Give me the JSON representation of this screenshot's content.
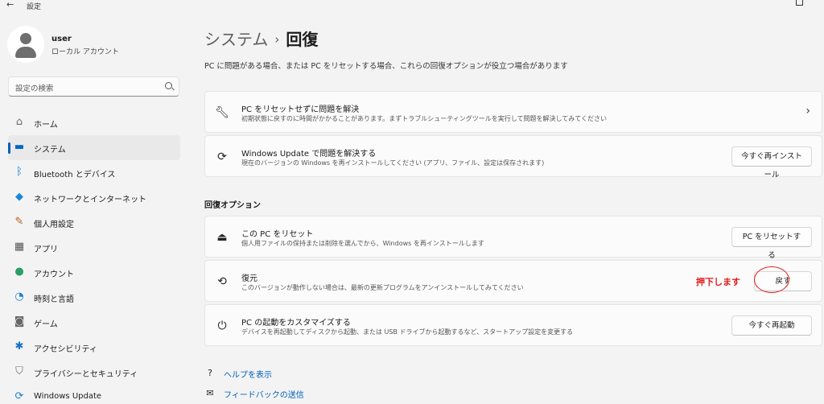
{
  "window": {
    "back_glyph": "←",
    "title": "設定"
  },
  "profile": {
    "name": "user",
    "account_type": "ローカル アカウント"
  },
  "search": {
    "placeholder": "設定の検索"
  },
  "nav": {
    "items": [
      {
        "label": "ホーム",
        "icon": "home-icon",
        "glyph": "⌂",
        "color": "#6b6b6b"
      },
      {
        "label": "システム",
        "icon": "monitor-icon",
        "glyph": "▬",
        "color": "#0067c0"
      },
      {
        "label": "Bluetooth とデバイス",
        "icon": "bluetooth-icon",
        "glyph": "ᛒ",
        "color": "#0a78d4"
      },
      {
        "label": "ネットワークとインターネット",
        "icon": "wifi-icon",
        "glyph": "◆",
        "color": "#1a86d8"
      },
      {
        "label": "個人用設定",
        "icon": "paintbrush-icon",
        "glyph": "✎",
        "color": "#b25c1c"
      },
      {
        "label": "アプリ",
        "icon": "apps-icon",
        "glyph": "▦",
        "color": "#555555"
      },
      {
        "label": "アカウント",
        "icon": "person-icon",
        "glyph": "●",
        "color": "#2a9d6a"
      },
      {
        "label": "時刻と言語",
        "icon": "globe-clock-icon",
        "glyph": "◔",
        "color": "#1a7fd0"
      },
      {
        "label": "ゲーム",
        "icon": "gamepad-icon",
        "glyph": "◙",
        "color": "#666666"
      },
      {
        "label": "アクセシビリティ",
        "icon": "accessibility-icon",
        "glyph": "✱",
        "color": "#1470c8"
      },
      {
        "label": "プライバシーとセキュリティ",
        "icon": "shield-icon",
        "glyph": "⛉",
        "color": "#6b6b6b"
      },
      {
        "label": "Windows Update",
        "icon": "update-icon",
        "glyph": "⟳",
        "color": "#1a7fd0"
      }
    ],
    "active_index": 1
  },
  "main": {
    "breadcrumb": {
      "parent": "システム",
      "separator": "›",
      "current": "回復"
    },
    "description": "PC に問題がある場合、または PC をリセットする場合、これらの回復オプションが役立つ場合があります",
    "troubleshoot_card": {
      "title": "PC をリセットせずに問題を解決",
      "subtitle": "初期状態に戻すのに時間がかかることがあります。まずトラブルシューティングツールを実行して問題を解決してみてください",
      "icon": "wrench-icon",
      "chevron": "›"
    },
    "update_fix_card": {
      "title": "Windows Update で問題を解決する",
      "subtitle": "現在のバージョンの Windows を再インストールしてください (アプリ、ファイル、設定は保存されます)",
      "button_label": "今すぐ再インストール",
      "icon": "sync-icon"
    },
    "section_title": "回復オプション",
    "reset_card": {
      "title": "この PC をリセット",
      "subtitle": "個人用ファイルの保持または削除を選んでから、Windows を再インストールします",
      "button_label": "PC をリセットする",
      "icon": "reset-pc-icon"
    },
    "restore_card": {
      "title": "復元",
      "subtitle": "このバージョンが動作しない場合は、最新の更新プログラムをアンインストールしてみてください",
      "button_label": "戻す",
      "icon": "history-icon"
    },
    "startup_card": {
      "title": "PC の起動をカスタマイズする",
      "subtitle": "デバイスを再起動してディスクから起動、または USB ドライブから起動するなど、スタートアップ設定を変更する",
      "button_label": "今すぐ再起動",
      "icon": "advanced-startup-icon"
    },
    "links": {
      "help": "ヘルプを表示",
      "feedback": "フィードバックの送信"
    }
  },
  "annotation": {
    "text": "押下します",
    "color": "#e01a1a"
  }
}
